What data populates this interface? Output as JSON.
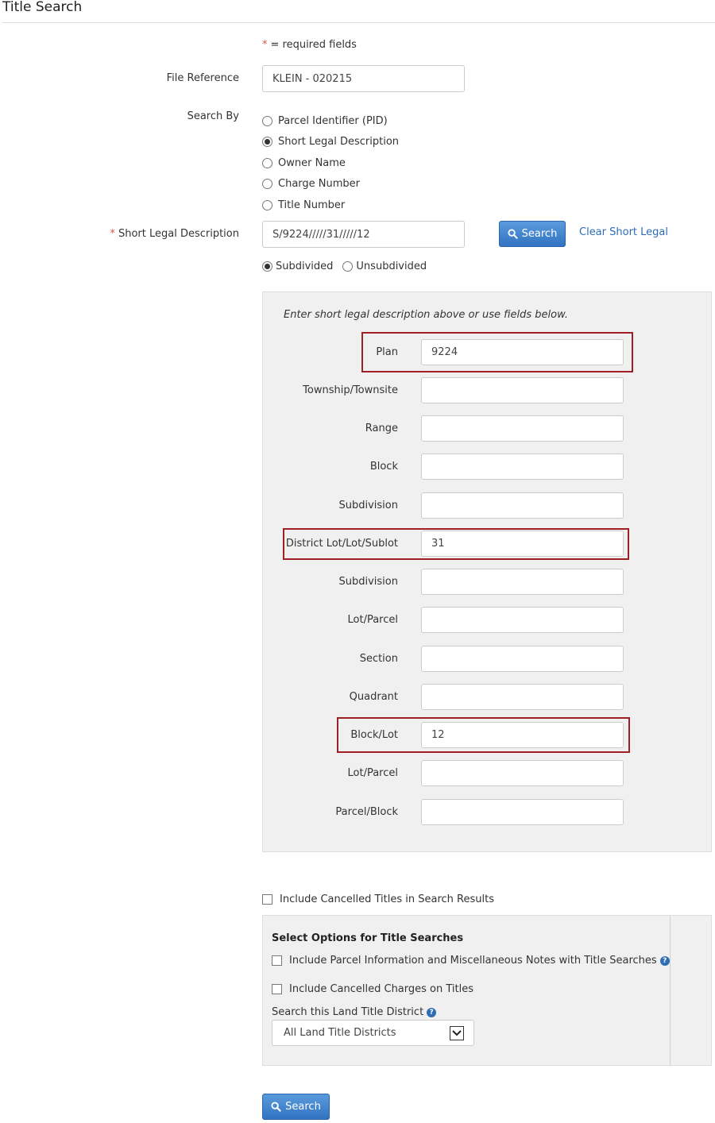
{
  "page": {
    "title": "Title Search",
    "required_note": "= required fields",
    "required_mark": "*"
  },
  "file_reference": {
    "label": "File Reference",
    "value": "KLEIN - 020215"
  },
  "search_by": {
    "label": "Search By",
    "options": [
      {
        "label": "Parcel Identifier (PID)",
        "selected": false
      },
      {
        "label": "Short Legal Description",
        "selected": true
      },
      {
        "label": "Owner Name",
        "selected": false
      },
      {
        "label": "Charge Number",
        "selected": false
      },
      {
        "label": "Title Number",
        "selected": false
      }
    ]
  },
  "short_legal": {
    "label": "Short Legal Description",
    "value": "S/9224/////31/////12",
    "search_label": "Search",
    "clear_label": "Clear Short Legal",
    "type_options": [
      {
        "label": "Subdivided",
        "selected": true
      },
      {
        "label": "Unsubdivided",
        "selected": false
      }
    ]
  },
  "fields_panel": {
    "hint": "Enter short legal description above or use fields below.",
    "fields": [
      {
        "label": "Plan",
        "value": "9224"
      },
      {
        "label": "Township/Townsite",
        "value": ""
      },
      {
        "label": "Range",
        "value": ""
      },
      {
        "label": "Block",
        "value": ""
      },
      {
        "label": "Subdivision",
        "value": ""
      },
      {
        "label": "District Lot/Lot/Sublot",
        "value": "31"
      },
      {
        "label": "Subdivision",
        "value": ""
      },
      {
        "label": "Lot/Parcel",
        "value": ""
      },
      {
        "label": "Section",
        "value": ""
      },
      {
        "label": "Quadrant",
        "value": ""
      },
      {
        "label": "Block/Lot",
        "value": "12"
      },
      {
        "label": "Lot/Parcel",
        "value": ""
      },
      {
        "label": "Parcel/Block",
        "value": ""
      }
    ]
  },
  "cancelled_titles": {
    "label": "Include Cancelled Titles in Search Results",
    "checked": false
  },
  "options": {
    "title": "Select Options for Title Searches",
    "parcel_info_label": "Include Parcel Information and Miscellaneous Notes with Title Searches",
    "cancelled_charges_label": "Include Cancelled Charges on Titles",
    "district_label": "Search this Land Title District",
    "district_value": "All Land Title Districts",
    "help_glyph": "?"
  },
  "footer": {
    "search_label": "Search"
  },
  "colors": {
    "primary": "#3173c1",
    "highlight": "#a01f24",
    "required": "#d9534f",
    "link": "#2e6db4"
  }
}
